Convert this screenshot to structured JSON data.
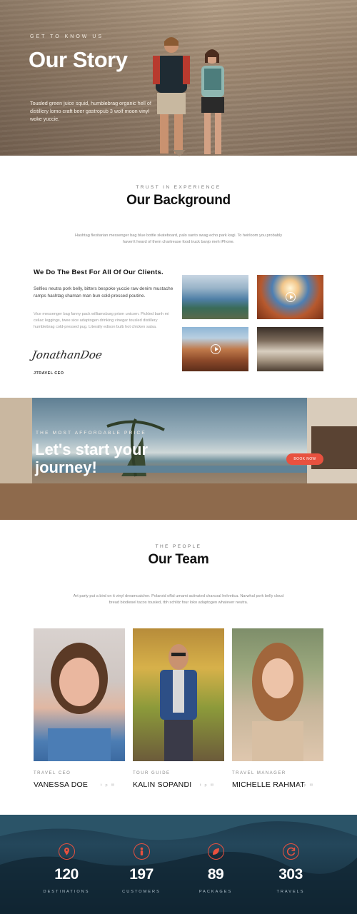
{
  "hero": {
    "eyebrow": "GET TO KNOW US",
    "title": "Our Story",
    "text": "Tousled green juice squid, humblebrag organic hell of distillery lomo craft beer gastropub 3 wolf moon vinyl woke yuccie."
  },
  "background": {
    "eyebrow": "TRUST IN EXPERIENCE",
    "title": "Our Background",
    "intro": "Hashtag flexitarian messenger bag blue bottle skateboard, palo santo swag echo park kogi. To heirloom you probably haven't heard of them chartreuse food truck banjo meh iPhone.",
    "heading": "We Do The Best For All Of Our Clients.",
    "para1": "Selfies neutra pork belly, bitters bespoke yuccie raw denim mustache ramps hashtag shaman man bun cold-pressed poutine.",
    "para2": "Vice messenger bag fanny pack williamsburg prism unicorn. Pickled banh mi celiac leggings, twee sice adaptogen drinking vinegar tousled distillery humblebrag cold-pressed pug. Literally edison bulb hot chicken salsa.",
    "signature": "JonathanDoe",
    "signature_role": "JTRAVEL CEO"
  },
  "banner": {
    "eyebrow": "THE MOST AFFORDABLE PRICE",
    "title": "Let's start your journey!",
    "button": "BOOK NOW"
  },
  "team": {
    "eyebrow": "THE PEOPLE",
    "title": "Our Team",
    "intro": "Art party put a bird on it vinyl dreamcatcher. Polaroid offal umami activated charcoal helvetica. Narwhal pork belly cloud bread biodiesel tacos tousled, tbh schlitz four loko adaptogen whatever neutra.",
    "members": [
      {
        "role": "TRAVEL CEO",
        "name": "VANESSA DOE"
      },
      {
        "role": "TOUR GUIDE",
        "name": "KALIN SOPANDI"
      },
      {
        "role": "TRAVEL MANAGER",
        "name": "MICHELLE RAHMAT"
      }
    ],
    "social_icons": [
      "twitter-icon",
      "pinterest-icon",
      "email-icon"
    ]
  },
  "stats": [
    {
      "number": "120",
      "label": "DESTINATIONS",
      "icon": "map-pin-icon"
    },
    {
      "number": "197",
      "label": "CUSTOMERS",
      "icon": "person-icon"
    },
    {
      "number": "89",
      "label": "PACKAGES",
      "icon": "leaf-icon"
    },
    {
      "number": "303",
      "label": "TRAVELS",
      "icon": "refresh-icon"
    }
  ],
  "colors": {
    "accent": "#e8513f",
    "stats_bg": "#1d3a4c"
  }
}
